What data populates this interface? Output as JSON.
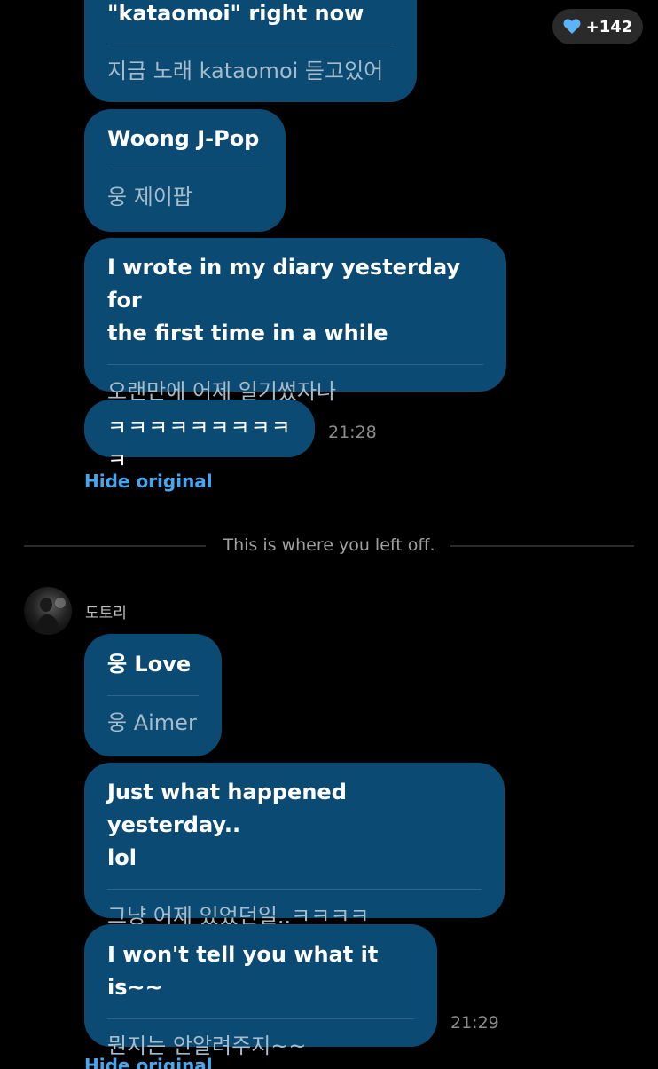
{
  "reactions": {
    "icon": "heart-icon",
    "color": "#5ab4f5",
    "count_label": "+142"
  },
  "messages_top": [
    {
      "original": "\"kataomoi\" right now",
      "translation": "지금 노래 kataomoi 듣고있어"
    },
    {
      "original": "Woong J-Pop",
      "translation": "웅 제이팝"
    },
    {
      "original_lines": [
        "I wrote in my diary yesterday for",
        "the first time in a while"
      ],
      "translation": "오랜만에 어제 일기썼자나"
    },
    {
      "original": "ㅋㅋㅋㅋㅋㅋㅋㅋㅋㅋ",
      "time": "21:28"
    }
  ],
  "hide_original_label": "Hide original",
  "left_off_label": "This is where you left off.",
  "sender": {
    "name": "도토리"
  },
  "messages_bottom": [
    {
      "original": "웅 Love",
      "translation": "웅 Aimer"
    },
    {
      "original_lines": [
        "Just what happened yesterday..",
        "lol"
      ],
      "translation": "그냥 어제 있었던일..ㅋㅋㅋㅋ"
    },
    {
      "original": "I won't tell you what it is~~",
      "translation": "뭔지는 안알려주지~~",
      "time": "21:29"
    }
  ],
  "bottom_peek_label": "Hide original",
  "colors": {
    "bubble": "#0b4a72",
    "link": "#46a7ef",
    "background": "#000000"
  }
}
